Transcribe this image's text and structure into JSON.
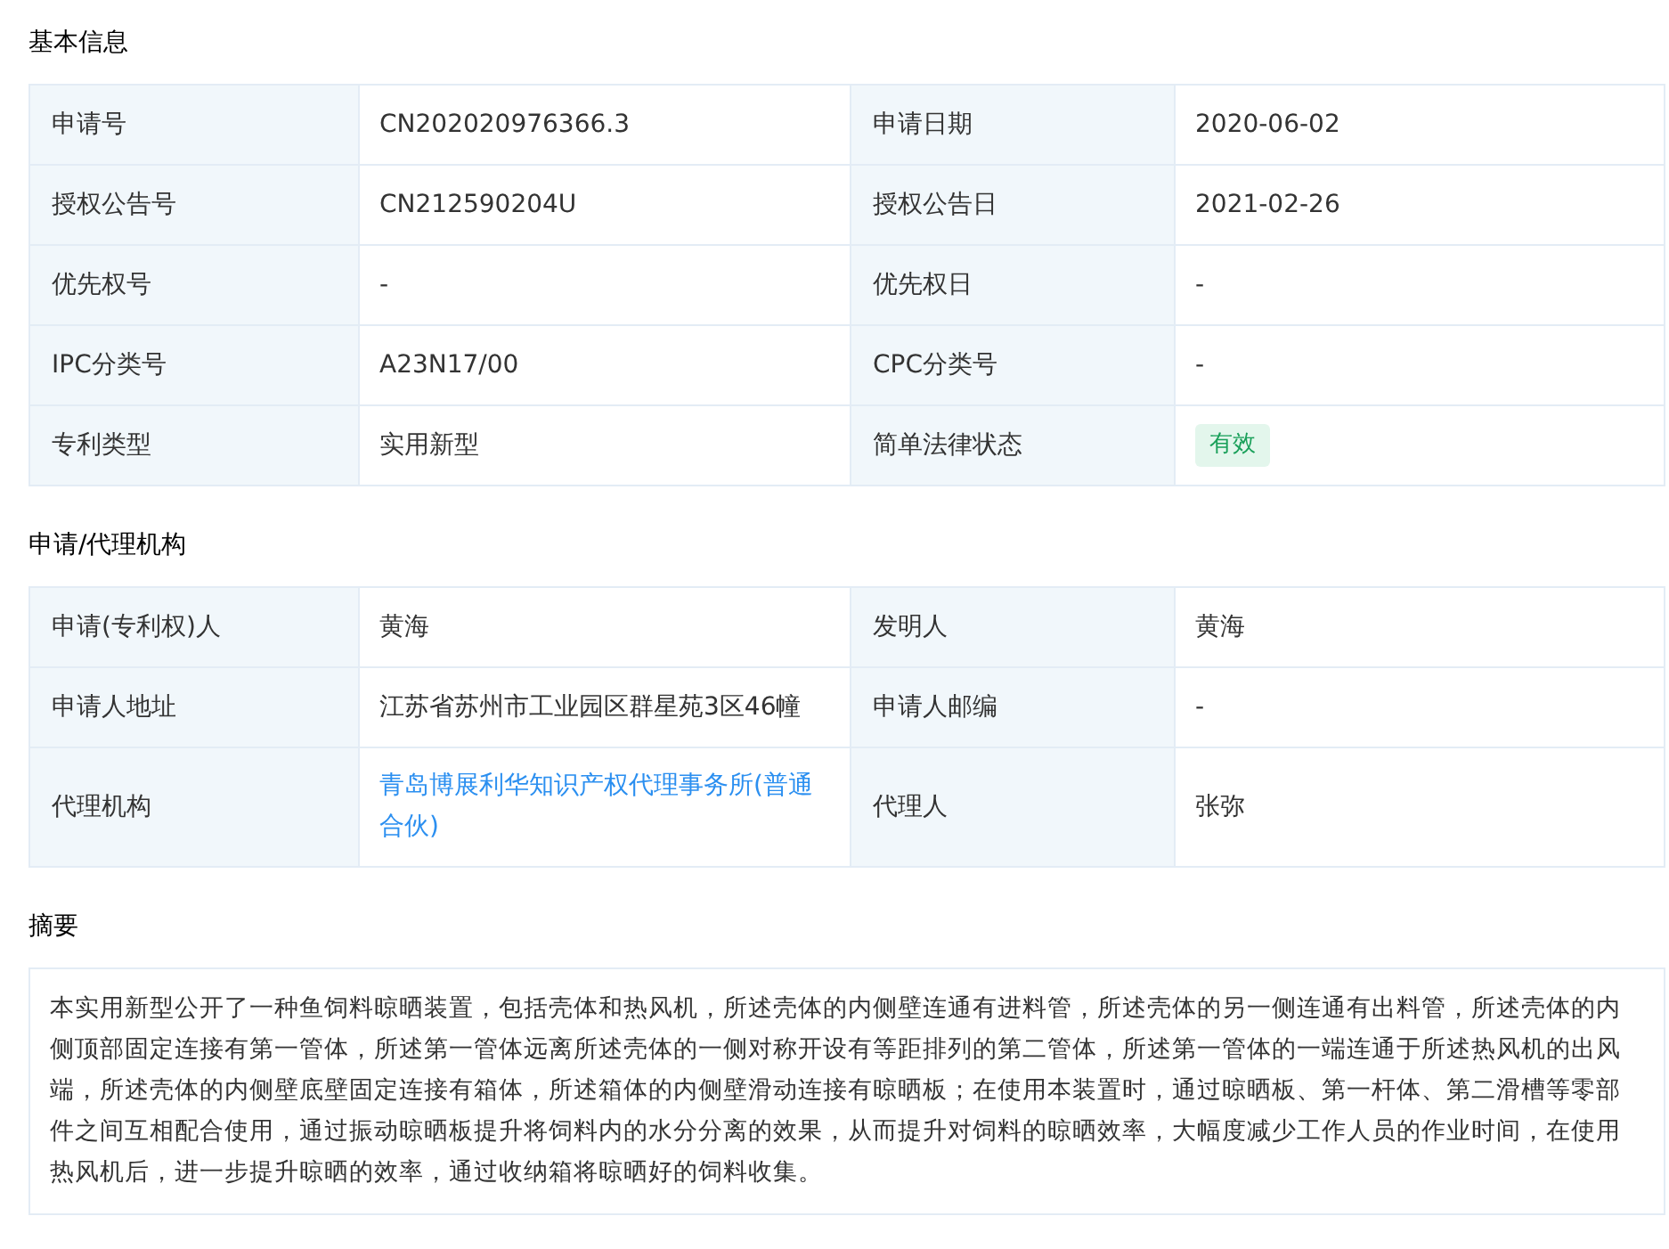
{
  "sections": [
    {
      "title": "基本信息",
      "kind": "table",
      "fields": [
        {
          "label": "申请号",
          "value": "CN202020976366.3",
          "kind": "text"
        },
        {
          "label": "申请日期",
          "value": "2020-06-02",
          "kind": "text"
        },
        {
          "label": "授权公告号",
          "value": "CN212590204U",
          "kind": "text"
        },
        {
          "label": "授权公告日",
          "value": "2021-02-26",
          "kind": "text"
        },
        {
          "label": "优先权号",
          "value": "-",
          "kind": "text"
        },
        {
          "label": "优先权日",
          "value": "-",
          "kind": "text"
        },
        {
          "label": "IPC分类号",
          "value": "A23N17/00",
          "kind": "text"
        },
        {
          "label": "CPC分类号",
          "value": "-",
          "kind": "text"
        },
        {
          "label": "专利类型",
          "value": "实用新型",
          "kind": "text"
        },
        {
          "label": "简单法律状态",
          "value": "有效",
          "kind": "badge"
        }
      ]
    },
    {
      "title": "申请/代理机构",
      "kind": "table",
      "fields": [
        {
          "label": "申请(专利权)人",
          "value": "黄海",
          "kind": "text"
        },
        {
          "label": "发明人",
          "value": "黄海",
          "kind": "text"
        },
        {
          "label": "申请人地址",
          "value": "江苏省苏州市工业园区群星苑3区46幢",
          "kind": "text"
        },
        {
          "label": "申请人邮编",
          "value": "-",
          "kind": "text"
        },
        {
          "label": "代理机构",
          "value": "青岛博展利华知识产权代理事务所(普通合伙)",
          "kind": "link"
        },
        {
          "label": "代理人",
          "value": "张弥",
          "kind": "text"
        }
      ]
    },
    {
      "title": "摘要",
      "kind": "text",
      "text": "本实用新型公开了一种鱼饲料晾晒装置，包括壳体和热风机，所述壳体的内侧壁连通有进料管，所述壳体的另一侧连通有出料管，所述壳体的内侧顶部固定连接有第一管体，所述第一管体远离所述壳体的一侧对称开设有等距排列的第二管体，所述第一管体的一端连通于所述热风机的出风端，所述壳体的内侧壁底壁固定连接有箱体，所述箱体的内侧壁滑动连接有晾晒板；在使用本装置时，通过晾晒板、第一杆体、第二滑槽等零部件之间互相配合使用，通过振动晾晒板提升将饲料内的水分分离的效果，从而提升对饲料的晾晒效率，大幅度减少工作人员的作业时间，在使用热风机后，进一步提升晾晒的效率，通过收纳箱将晾晒好的饲料收集。"
    }
  ]
}
